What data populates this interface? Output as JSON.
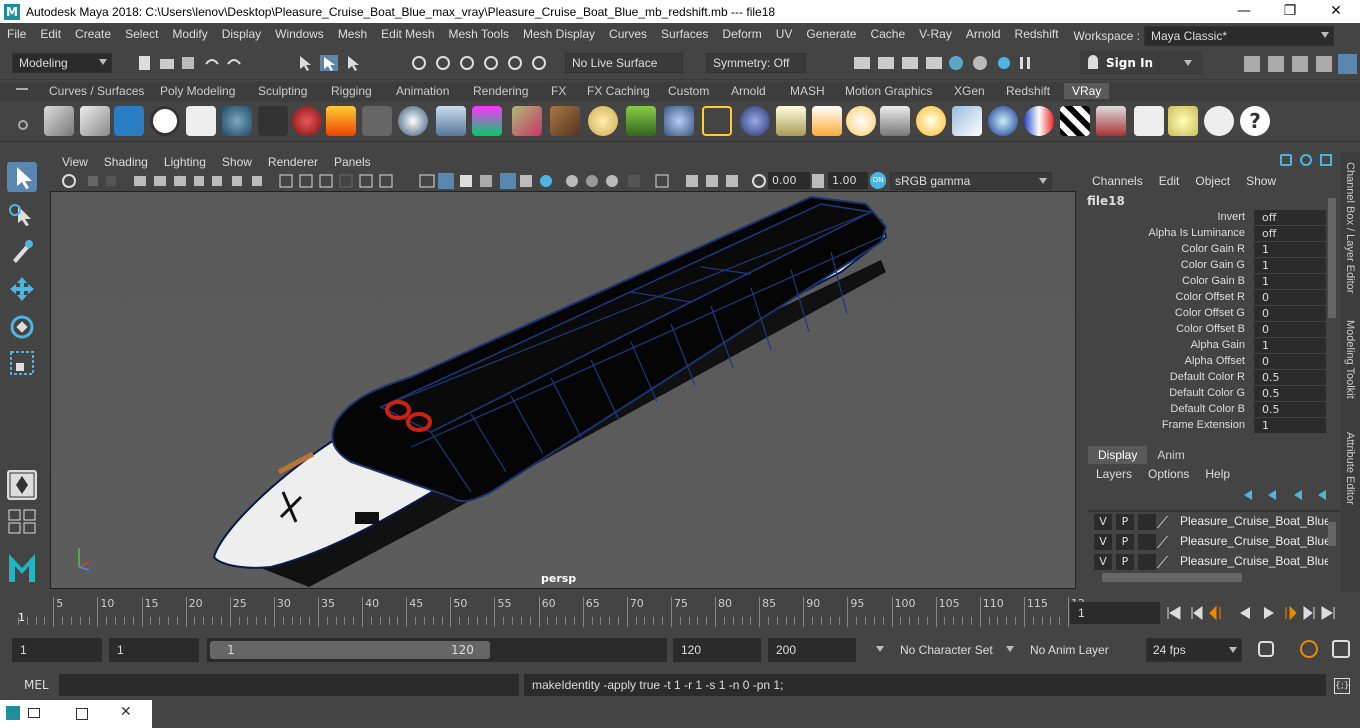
{
  "window": {
    "title": "Autodesk Maya 2018: C:\\Users\\lenov\\Desktop\\Pleasure_Cruise_Boat_Blue_max_vray\\Pleasure_Cruise_Boat_Blue_mb_redshift.mb   ---   file18",
    "min": "—",
    "max": "❐",
    "close": "✕"
  },
  "menu": [
    "File",
    "Edit",
    "Create",
    "Select",
    "Modify",
    "Display",
    "Windows",
    "Mesh",
    "Edit Mesh",
    "Mesh Tools",
    "Mesh Display",
    "Curves",
    "Surfaces",
    "Deform",
    "UV",
    "Generate",
    "Cache",
    "V-Ray",
    "Arnold",
    "Redshift"
  ],
  "workspace": {
    "label": "Workspace :",
    "value": "Maya Classic*"
  },
  "status": {
    "mode": "Modeling",
    "live_surface": "No Live Surface",
    "symmetry": "Symmetry: Off",
    "sign_in": "Sign In"
  },
  "shelf_tabs": [
    "Curves / Surfaces",
    "Poly Modeling",
    "Sculpting",
    "Rigging",
    "Animation",
    "Rendering",
    "FX",
    "FX Caching",
    "Custom",
    "Arnold",
    "MASH",
    "Motion Graphics",
    "XGen",
    "Redshift",
    "VRay"
  ],
  "shelf_active": "VRay",
  "viewport": {
    "menus": [
      "View",
      "Shading",
      "Lighting",
      "Show",
      "Renderer",
      "Panels"
    ],
    "exposure": "0.00",
    "gamma": "1.00",
    "color_space": "sRGB gamma",
    "camera": "persp"
  },
  "channel_box": {
    "menus": [
      "Channels",
      "Edit",
      "Object",
      "Show"
    ],
    "object": "file18",
    "attrs": [
      {
        "name": "Invert",
        "value": "off"
      },
      {
        "name": "Alpha Is Luminance",
        "value": "off"
      },
      {
        "name": "Color Gain R",
        "value": "1"
      },
      {
        "name": "Color Gain G",
        "value": "1"
      },
      {
        "name": "Color Gain B",
        "value": "1"
      },
      {
        "name": "Color Offset R",
        "value": "0"
      },
      {
        "name": "Color Offset G",
        "value": "0"
      },
      {
        "name": "Color Offset B",
        "value": "0"
      },
      {
        "name": "Alpha Gain",
        "value": "1"
      },
      {
        "name": "Alpha Offset",
        "value": "0"
      },
      {
        "name": "Default Color R",
        "value": "0.5"
      },
      {
        "name": "Default Color G",
        "value": "0.5"
      },
      {
        "name": "Default Color B",
        "value": "0.5"
      },
      {
        "name": "Frame Extension",
        "value": "1"
      }
    ]
  },
  "side_tabs": [
    "Channel Box / Layer Editor",
    "Modeling Toolkit",
    "Attribute Editor"
  ],
  "layers": {
    "tabs": [
      "Display",
      "Anim"
    ],
    "menus": [
      "Layers",
      "Options",
      "Help"
    ],
    "rows": [
      {
        "v": "V",
        "p": "P",
        "name": "Pleasure_Cruise_Boat_Blue_l"
      },
      {
        "v": "V",
        "p": "P",
        "name": "Pleasure_Cruise_Boat_Blue_l"
      },
      {
        "v": "V",
        "p": "P",
        "name": "Pleasure_Cruise_Boat_Blue_l"
      }
    ]
  },
  "timeline": {
    "ticks": [
      "5",
      "10",
      "15",
      "20",
      "25",
      "30",
      "35",
      "40",
      "45",
      "50",
      "55",
      "60",
      "65",
      "70",
      "75",
      "80",
      "85",
      "90",
      "95",
      "100",
      "105",
      "110",
      "115",
      "12"
    ],
    "start_marker": "1",
    "current_frame": "1"
  },
  "range": {
    "start": "1",
    "anim_start": "1",
    "slider_start": "1",
    "slider_end": "120",
    "end": "120",
    "anim_end": "200",
    "character_set": "No Character Set",
    "anim_layer": "No Anim Layer",
    "fps": "24 fps"
  },
  "command": {
    "lang": "MEL",
    "output": "makeIdentity -apply true -t 1 -r 1 -s 1 -n 0 -pn 1;"
  }
}
